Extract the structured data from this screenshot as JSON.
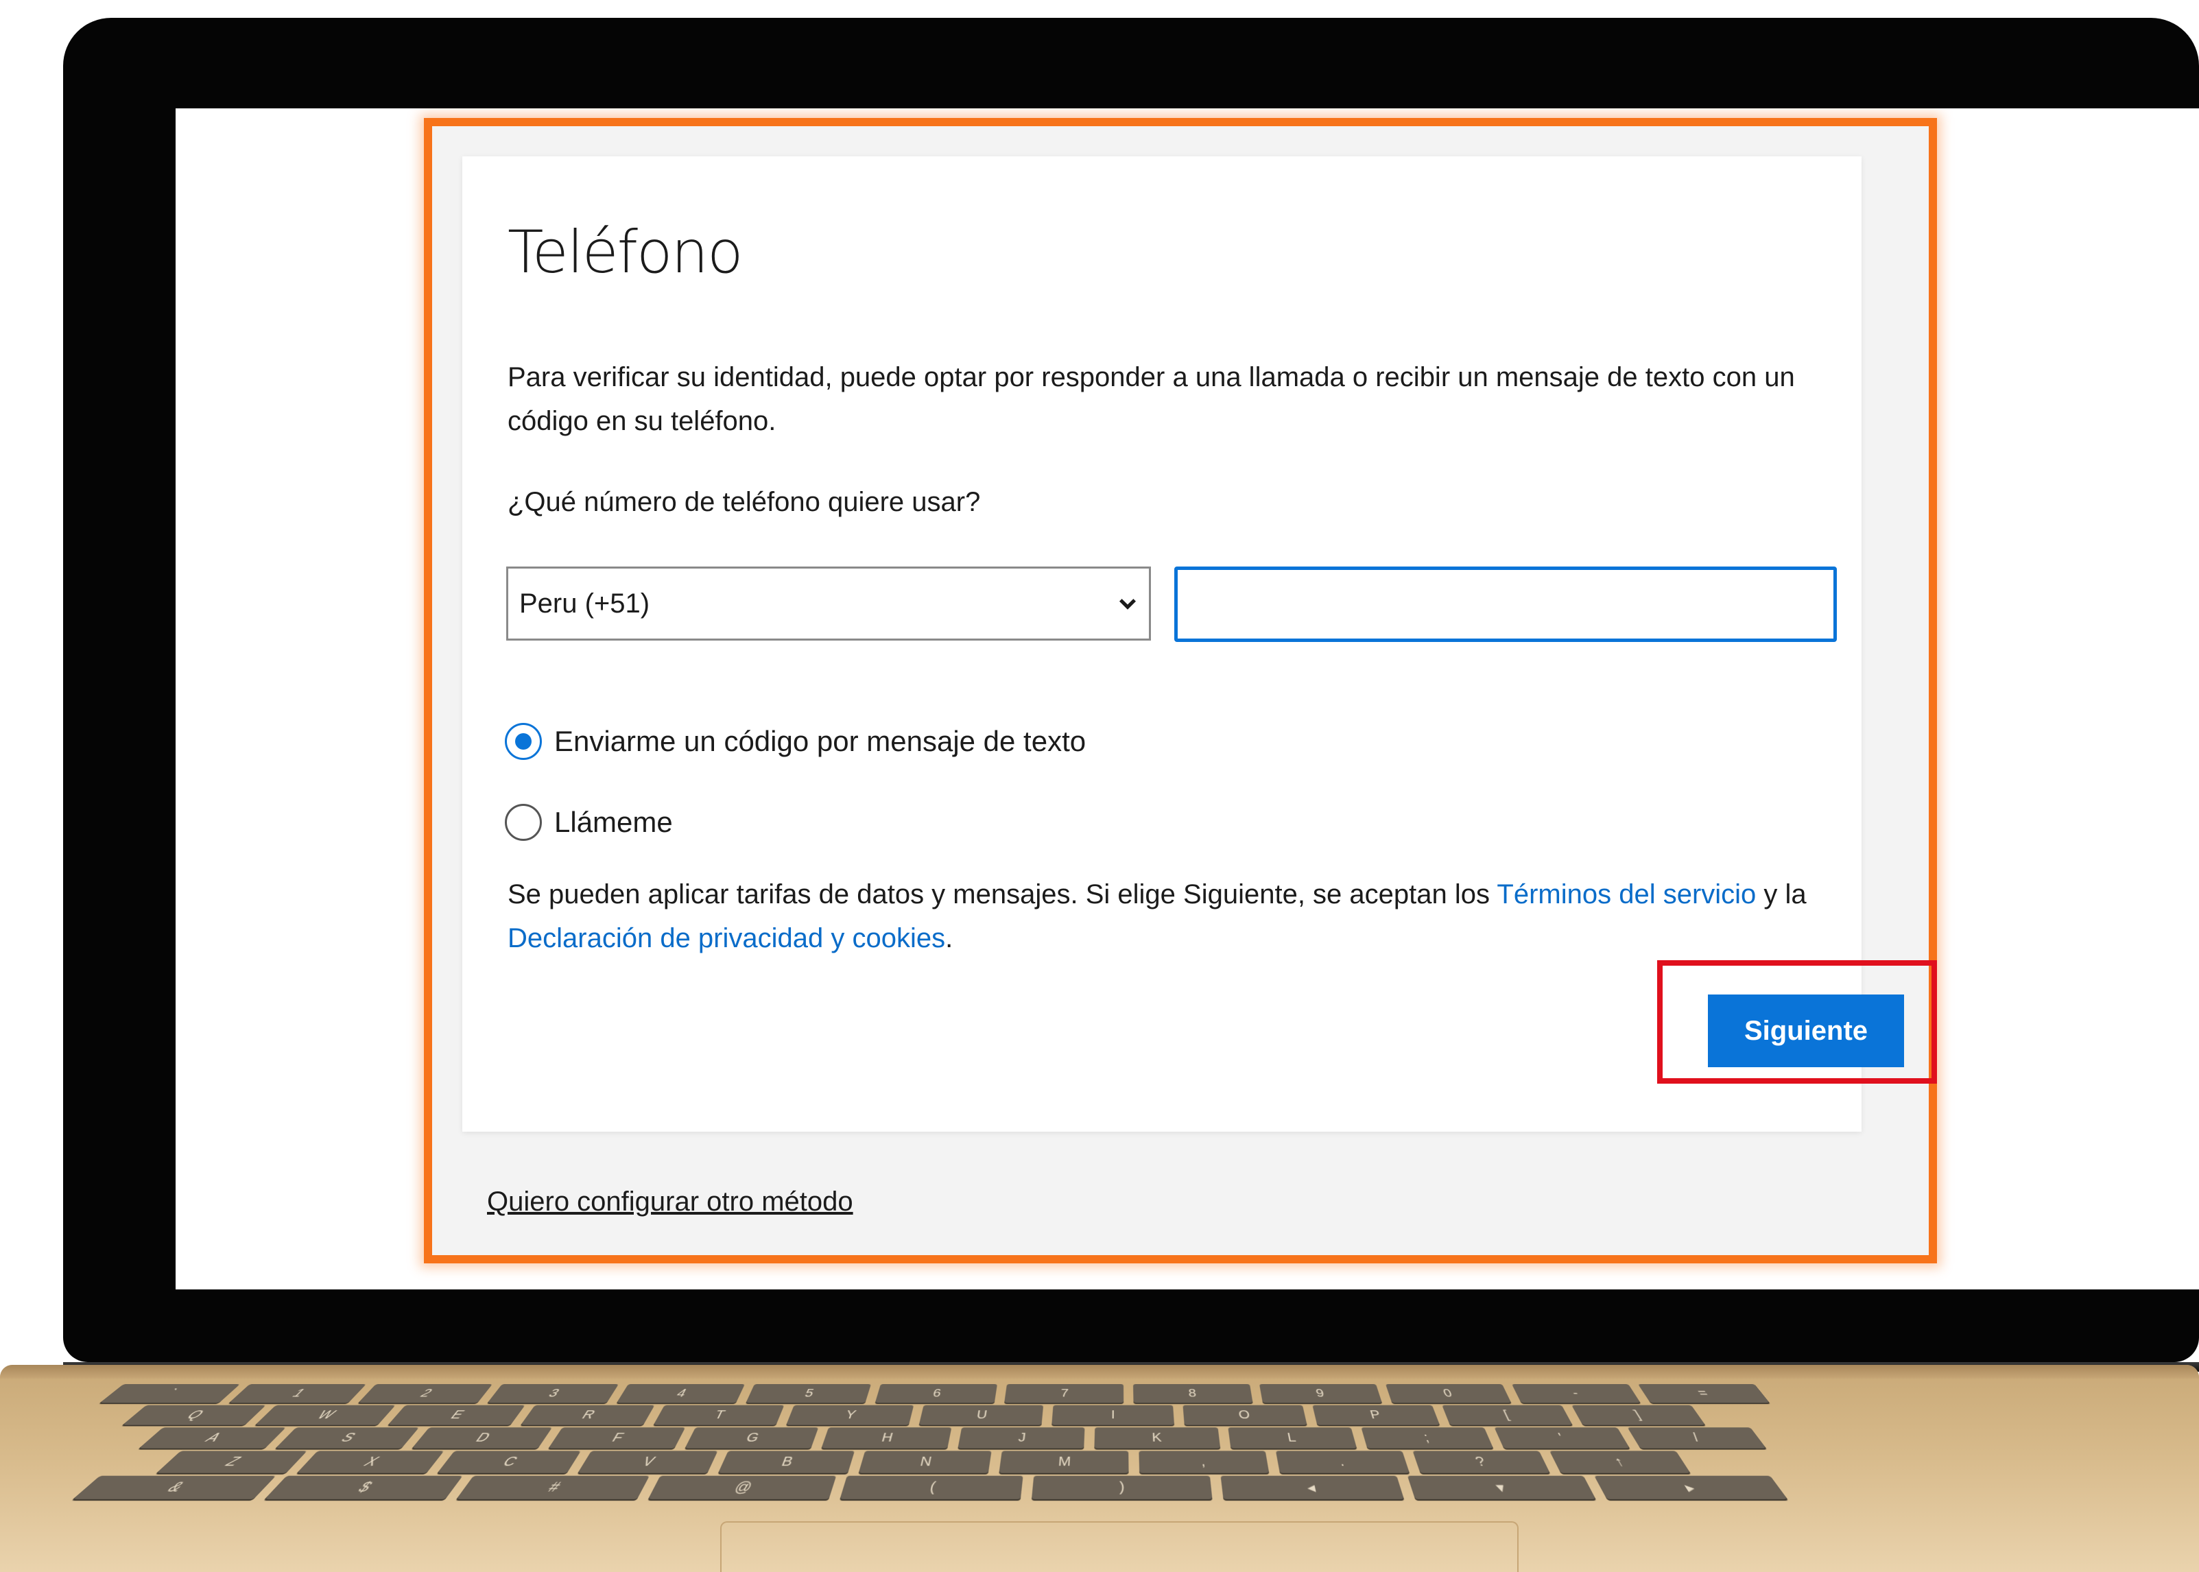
{
  "dialog": {
    "title": "Teléfono",
    "description": "Para verificar su identidad, puede optar por responder a una llamada o recibir un mensaje de texto con un código en su teléfono.",
    "question": "¿Qué número de teléfono quiere usar?",
    "country_select": {
      "value": "Peru (+51)"
    },
    "phone_input": {
      "value": "",
      "placeholder": ""
    },
    "options": [
      {
        "label": "Enviarme un código por mensaje de texto",
        "selected": true
      },
      {
        "label": "Llámeme",
        "selected": false
      }
    ],
    "terms": {
      "prefix": "Se pueden aplicar tarifas de datos y mensajes. Si elige Siguiente, se aceptan los ",
      "terms_link": "Términos del servicio",
      "middle": " y la ",
      "privacy_link": "Declaración de privacidad y cookies",
      "suffix": "."
    },
    "next_button": "Siguiente",
    "other_method_link": "Quiero configurar otro método"
  },
  "colors": {
    "highlight_frame": "#f7731a",
    "button_highlight": "#e0101d",
    "primary": "#0a74d8",
    "link": "#0a6cc9"
  },
  "keyboard": {
    "rows": [
      [
        "`",
        "1",
        "2",
        "3",
        "4",
        "5",
        "6",
        "7",
        "8",
        "9",
        "0",
        "-",
        "="
      ],
      [
        "Q",
        "W",
        "E",
        "R",
        "T",
        "Y",
        "U",
        "I",
        "O",
        "P",
        "[",
        "]"
      ],
      [
        "A",
        "S",
        "D",
        "F",
        "G",
        "H",
        "J",
        "K",
        "L",
        ";",
        "'",
        "/"
      ],
      [
        "Z",
        "X",
        "C",
        "V",
        "B",
        "N",
        "M",
        ",",
        ".",
        "?",
        "↑"
      ],
      [
        "&",
        "$",
        "#",
        "@",
        "(",
        ")",
        "◂",
        "▾",
        "▸"
      ]
    ]
  }
}
